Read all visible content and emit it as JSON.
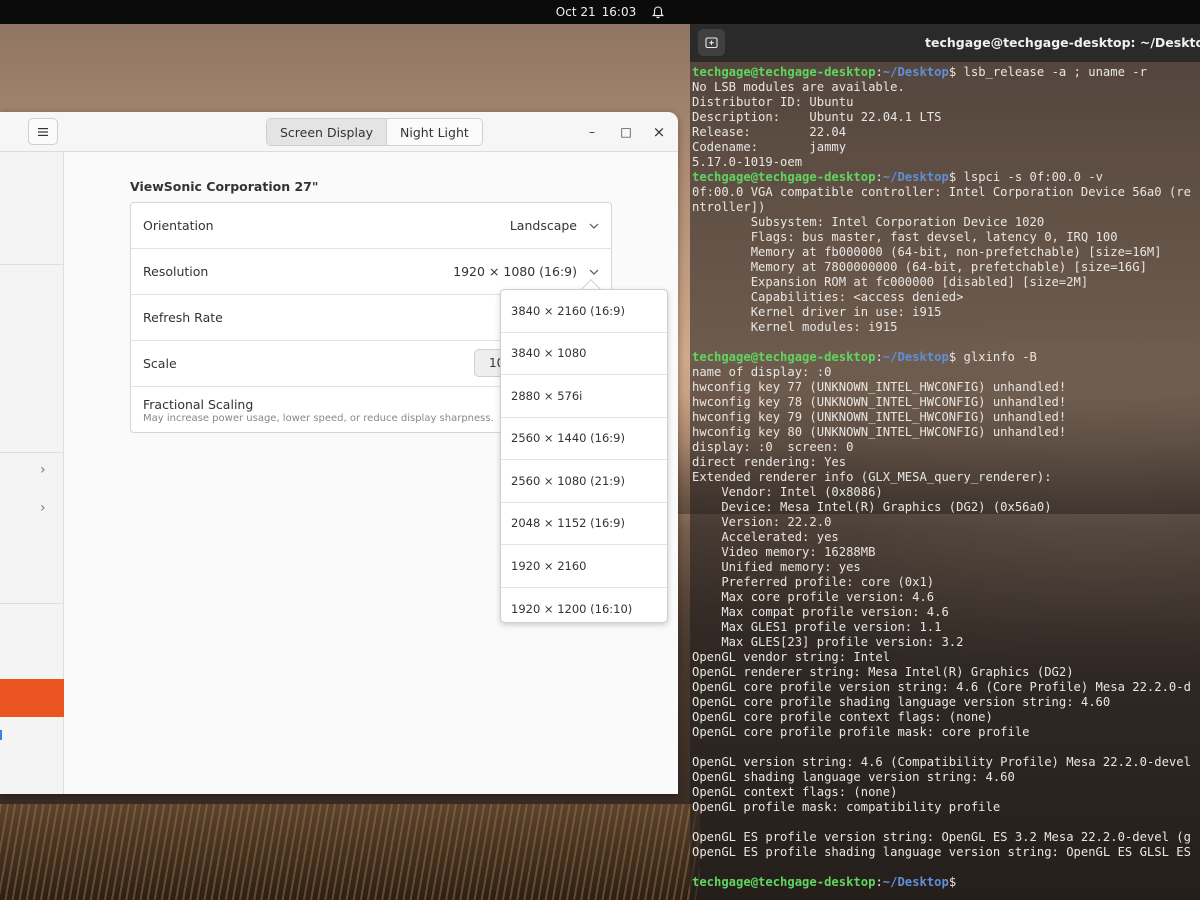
{
  "topbar": {
    "date": "Oct 21",
    "time": "16:03"
  },
  "settings": {
    "tabs": [
      {
        "label": "Screen Display",
        "active": true
      },
      {
        "label": "Night Light",
        "active": false
      }
    ],
    "window_controls": {
      "minimize": "–",
      "maximize": "□",
      "close": "×"
    },
    "sidebar": {
      "chevrons": [
        "›",
        "›"
      ]
    },
    "monitor_name": "ViewSonic Corporation 27\"",
    "rows": {
      "orientation": {
        "label": "Orientation",
        "value": "Landscape"
      },
      "resolution": {
        "label": "Resolution",
        "value": "1920 × 1080 (16:9)"
      },
      "refresh_rate": {
        "label": "Refresh Rate"
      },
      "scale": {
        "label": "Scale",
        "value": "10"
      },
      "fractional_scaling": {
        "label": "Fractional Scaling",
        "subtitle": "May increase power usage, lower speed, or reduce display sharpness."
      }
    },
    "resolution_options": [
      "3840 × 2160 (16:9)",
      "3840 × 1080",
      "2880 × 576i",
      "2560 × 1440 (16:9)",
      "2560 × 1080 (21:9)",
      "2048 × 1152 (16:9)",
      "1920 × 2160",
      "1920 × 1200 (16:10)"
    ]
  },
  "terminal": {
    "title": "techgage@techgage-desktop: ~/Desktop",
    "prompt_user": "techgage@techgage-desktop",
    "prompt_sep": ":",
    "prompt_path": "~/Desktop",
    "lines": [
      {
        "cmd": "lsb_release -a ; uname -r"
      },
      {
        "text": "No LSB modules are available."
      },
      {
        "text": "Distributor ID: Ubuntu"
      },
      {
        "text": "Description:    Ubuntu 22.04.1 LTS"
      },
      {
        "text": "Release:        22.04"
      },
      {
        "text": "Codename:       jammy"
      },
      {
        "text": "5.17.0-1019-oem"
      },
      {
        "cmd": "lspci -s 0f:00.0 -v"
      },
      {
        "text": "0f:00.0 VGA compatible controller: Intel Corporation Device 56a0 (re"
      },
      {
        "text": "ntroller])"
      },
      {
        "text": "        Subsystem: Intel Corporation Device 1020"
      },
      {
        "text": "        Flags: bus master, fast devsel, latency 0, IRQ 100"
      },
      {
        "text": "        Memory at fb000000 (64-bit, non-prefetchable) [size=16M]"
      },
      {
        "text": "        Memory at 7800000000 (64-bit, prefetchable) [size=16G]"
      },
      {
        "text": "        Expansion ROM at fc000000 [disabled] [size=2M]"
      },
      {
        "text": "        Capabilities: <access denied>"
      },
      {
        "text": "        Kernel driver in use: i915"
      },
      {
        "text": "        Kernel modules: i915"
      },
      {
        "text": ""
      },
      {
        "cmd": "glxinfo -B"
      },
      {
        "text": "name of display: :0"
      },
      {
        "text": "hwconfig key 77 (UNKNOWN_INTEL_HWCONFIG) unhandled!"
      },
      {
        "text": "hwconfig key 78 (UNKNOWN_INTEL_HWCONFIG) unhandled!"
      },
      {
        "text": "hwconfig key 79 (UNKNOWN_INTEL_HWCONFIG) unhandled!"
      },
      {
        "text": "hwconfig key 80 (UNKNOWN_INTEL_HWCONFIG) unhandled!"
      },
      {
        "text": "display: :0  screen: 0"
      },
      {
        "text": "direct rendering: Yes"
      },
      {
        "text": "Extended renderer info (GLX_MESA_query_renderer):"
      },
      {
        "text": "    Vendor: Intel (0x8086)"
      },
      {
        "text": "    Device: Mesa Intel(R) Graphics (DG2) (0x56a0)"
      },
      {
        "text": "    Version: 22.2.0"
      },
      {
        "text": "    Accelerated: yes"
      },
      {
        "text": "    Video memory: 16288MB"
      },
      {
        "text": "    Unified memory: yes"
      },
      {
        "text": "    Preferred profile: core (0x1)"
      },
      {
        "text": "    Max core profile version: 4.6"
      },
      {
        "text": "    Max compat profile version: 4.6"
      },
      {
        "text": "    Max GLES1 profile version: 1.1"
      },
      {
        "text": "    Max GLES[23] profile version: 3.2"
      },
      {
        "text": "OpenGL vendor string: Intel"
      },
      {
        "text": "OpenGL renderer string: Mesa Intel(R) Graphics (DG2)"
      },
      {
        "text": "OpenGL core profile version string: 4.6 (Core Profile) Mesa 22.2.0-d"
      },
      {
        "text": "OpenGL core profile shading language version string: 4.60"
      },
      {
        "text": "OpenGL core profile context flags: (none)"
      },
      {
        "text": "OpenGL core profile profile mask: core profile"
      },
      {
        "text": ""
      },
      {
        "text": "OpenGL version string: 4.6 (Compatibility Profile) Mesa 22.2.0-devel"
      },
      {
        "text": "OpenGL shading language version string: 4.60"
      },
      {
        "text": "OpenGL context flags: (none)"
      },
      {
        "text": "OpenGL profile mask: compatibility profile"
      },
      {
        "text": ""
      },
      {
        "text": "OpenGL ES profile version string: OpenGL ES 3.2 Mesa 22.2.0-devel (g"
      },
      {
        "text": "OpenGL ES profile shading language version string: OpenGL ES GLSL ES"
      },
      {
        "text": ""
      },
      {
        "cmd": ""
      }
    ]
  }
}
